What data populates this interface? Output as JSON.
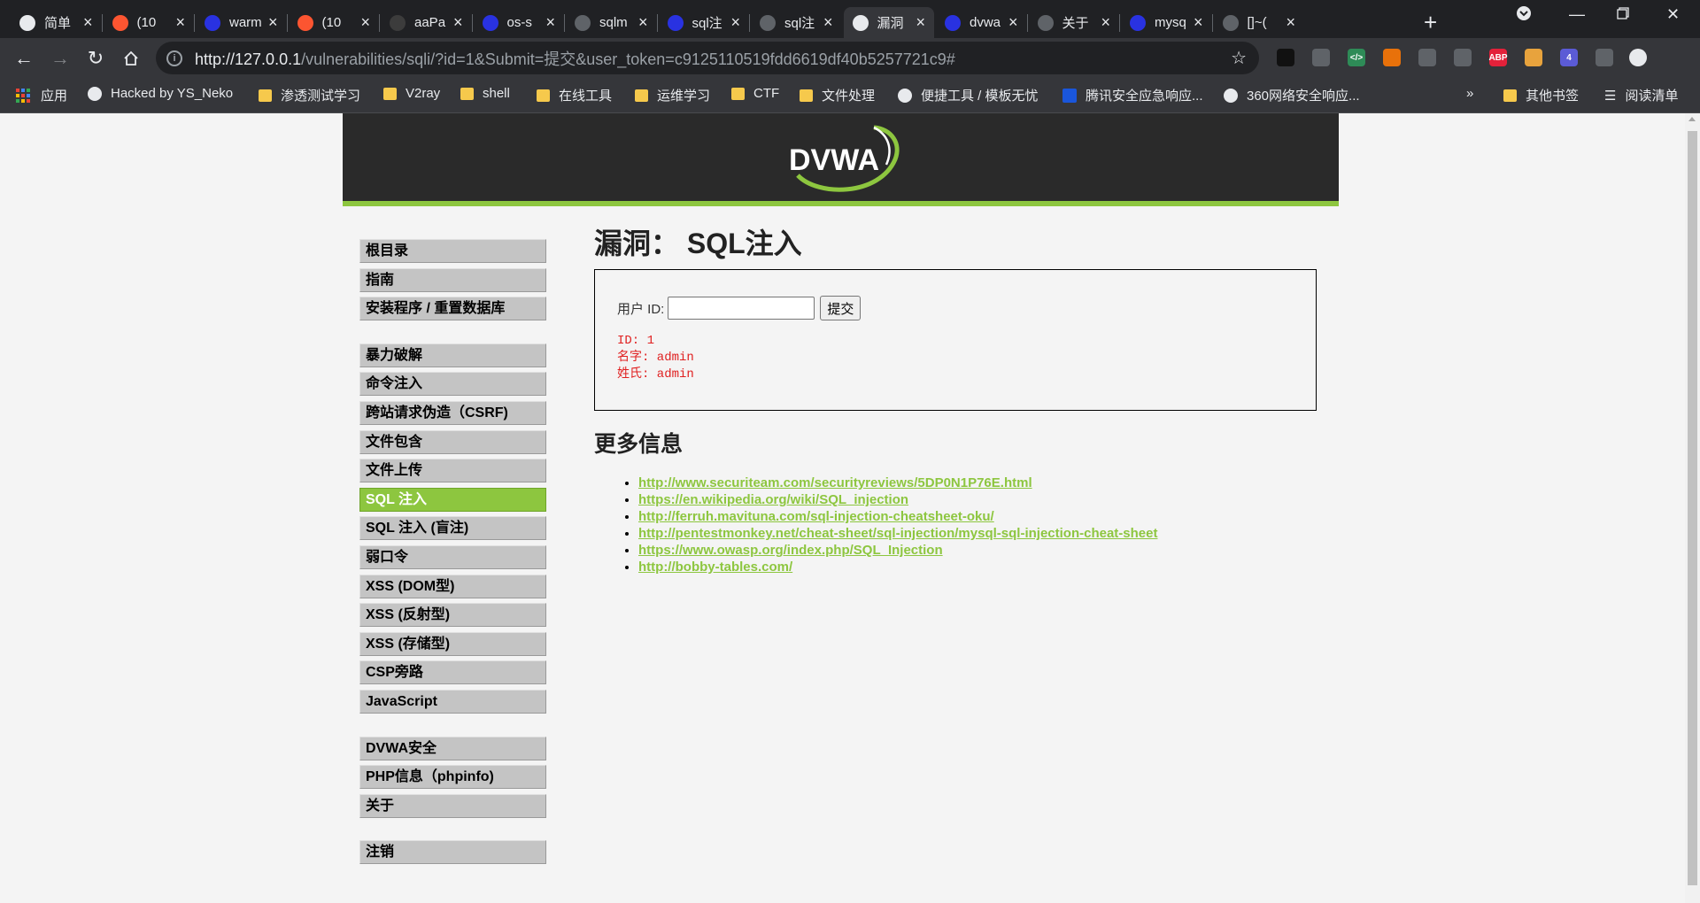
{
  "browser": {
    "tabs": [
      {
        "title": "简单",
        "icon": "globe-icon",
        "color": "#e8eaed"
      },
      {
        "title": "(10",
        "icon": "csdn-icon",
        "color": "#fc5531"
      },
      {
        "title": "warm",
        "icon": "baidu-paw-icon",
        "color": "#2932e1"
      },
      {
        "title": "(10",
        "icon": "csdn-icon",
        "color": "#fc5531"
      },
      {
        "title": "aaPa",
        "icon": "bt-icon",
        "color": "#3c3c3c"
      },
      {
        "title": "os-s",
        "icon": "baidu-paw-icon",
        "color": "#2932e1"
      },
      {
        "title": "sqlm",
        "icon": "dark-site-icon",
        "color": "#5f6368"
      },
      {
        "title": "sql注",
        "icon": "baidu-paw-icon",
        "color": "#2932e1"
      },
      {
        "title": "sql注",
        "icon": "dark-site-icon",
        "color": "#5f6368"
      },
      {
        "title": "漏洞",
        "icon": "globe-icon",
        "color": "#e8eaed"
      },
      {
        "title": "dvwa",
        "icon": "baidu-paw-icon",
        "color": "#2932e1"
      },
      {
        "title": "关于",
        "icon": "dark-site-icon",
        "color": "#5f6368"
      },
      {
        "title": "mysq",
        "icon": "baidu-paw-icon",
        "color": "#2932e1"
      },
      {
        "title": "[]~(",
        "icon": "dark-site-icon",
        "color": "#5f6368"
      }
    ],
    "active_tab_index": 9,
    "url_host": "http://127.0.0.1",
    "url_path": "/vulnerabilities/sqli/?id=1&Submit=提交&user_token=c9125110519fdd6619df40b5257721c9#",
    "bookmarks": [
      {
        "label": "应用",
        "icon": "apps-grid-icon"
      },
      {
        "label": "Hacked by YS_Neko",
        "icon": "globe-icon"
      },
      {
        "label": "渗透测试学习",
        "icon": "folder-icon"
      },
      {
        "label": "V2ray",
        "icon": "folder-icon"
      },
      {
        "label": "shell",
        "icon": "folder-icon"
      },
      {
        "label": "在线工具",
        "icon": "folder-icon"
      },
      {
        "label": "运维学习",
        "icon": "folder-icon"
      },
      {
        "label": "CTF",
        "icon": "folder-icon"
      },
      {
        "label": "文件处理",
        "icon": "folder-icon"
      },
      {
        "label": "便捷工具 / 模板无忧",
        "icon": "globe-icon"
      },
      {
        "label": "腾讯安全应急响应...",
        "icon": "tencent-icon"
      },
      {
        "label": "360网络安全响应...",
        "icon": "globe-icon"
      }
    ],
    "bookmarks_overflow": "»",
    "other_bookmarks": "其他书签",
    "reading_list": "阅读清单",
    "extensions": [
      {
        "name": "extension-dark-icon",
        "label": "",
        "color": "#111111"
      },
      {
        "name": "extension-ninja-icon",
        "label": "",
        "color": "#5f6368"
      },
      {
        "name": "extension-code-icon",
        "label": "</>",
        "color": "#2e8b57"
      },
      {
        "name": "extension-orange-icon",
        "label": "",
        "color": "#e8710a"
      },
      {
        "name": "extension-glasses-icon",
        "label": "",
        "color": "#5f6368"
      },
      {
        "name": "extension-hacker-icon",
        "label": "",
        "color": "#5f6368"
      },
      {
        "name": "extension-abp-icon",
        "label": "ABP",
        "color": "#e3213a"
      },
      {
        "name": "extension-cookie-icon",
        "label": "",
        "color": "#e8a33d"
      },
      {
        "name": "extension-php-icon",
        "label": "4",
        "color": "#5b5bd6"
      },
      {
        "name": "extensions-puzzle-icon",
        "label": "",
        "color": "#5f6368"
      },
      {
        "name": "profile-avatar-icon",
        "label": "",
        "color": "#e8eaed"
      }
    ]
  },
  "dvwa": {
    "logo_text": "DVWA",
    "menu_groups": [
      [
        "根目录",
        "指南",
        "安装程序 / 重置数据库"
      ],
      [
        "暴力破解",
        "命令注入",
        "跨站请求伪造（CSRF)",
        "文件包含",
        "文件上传",
        "SQL 注入",
        "SQL 注入 (盲注)",
        "弱口令",
        "XSS (DOM型)",
        "XSS (反射型)",
        "XSS (存储型)",
        "CSP旁路",
        "JavaScript"
      ],
      [
        "DVWA安全",
        "PHP信息（phpinfo)",
        "关于"
      ],
      [
        "注销"
      ]
    ],
    "selected_menu": "SQL 注入",
    "page_title": "漏洞： SQL注入",
    "form": {
      "label": "用户 ID:",
      "input_value": "",
      "submit_label": "提交"
    },
    "result_lines": [
      "ID: 1",
      "名字: admin",
      "姓氏: admin"
    ],
    "more_info_title": "更多信息",
    "links": [
      "http://www.securiteam.com/securityreviews/5DP0N1P76E.html",
      "https://en.wikipedia.org/wiki/SQL_injection",
      "http://ferruh.mavituna.com/sql-injection-cheatsheet-oku/",
      "http://pentestmonkey.net/cheat-sheet/sql-injection/mysql-sql-injection-cheat-sheet",
      "https://www.owasp.org/index.php/SQL_Injection",
      "http://bobby-tables.com/"
    ],
    "accent_color": "#8dc63f",
    "header_color": "#2a2a2a",
    "result_color": "#e02020"
  }
}
